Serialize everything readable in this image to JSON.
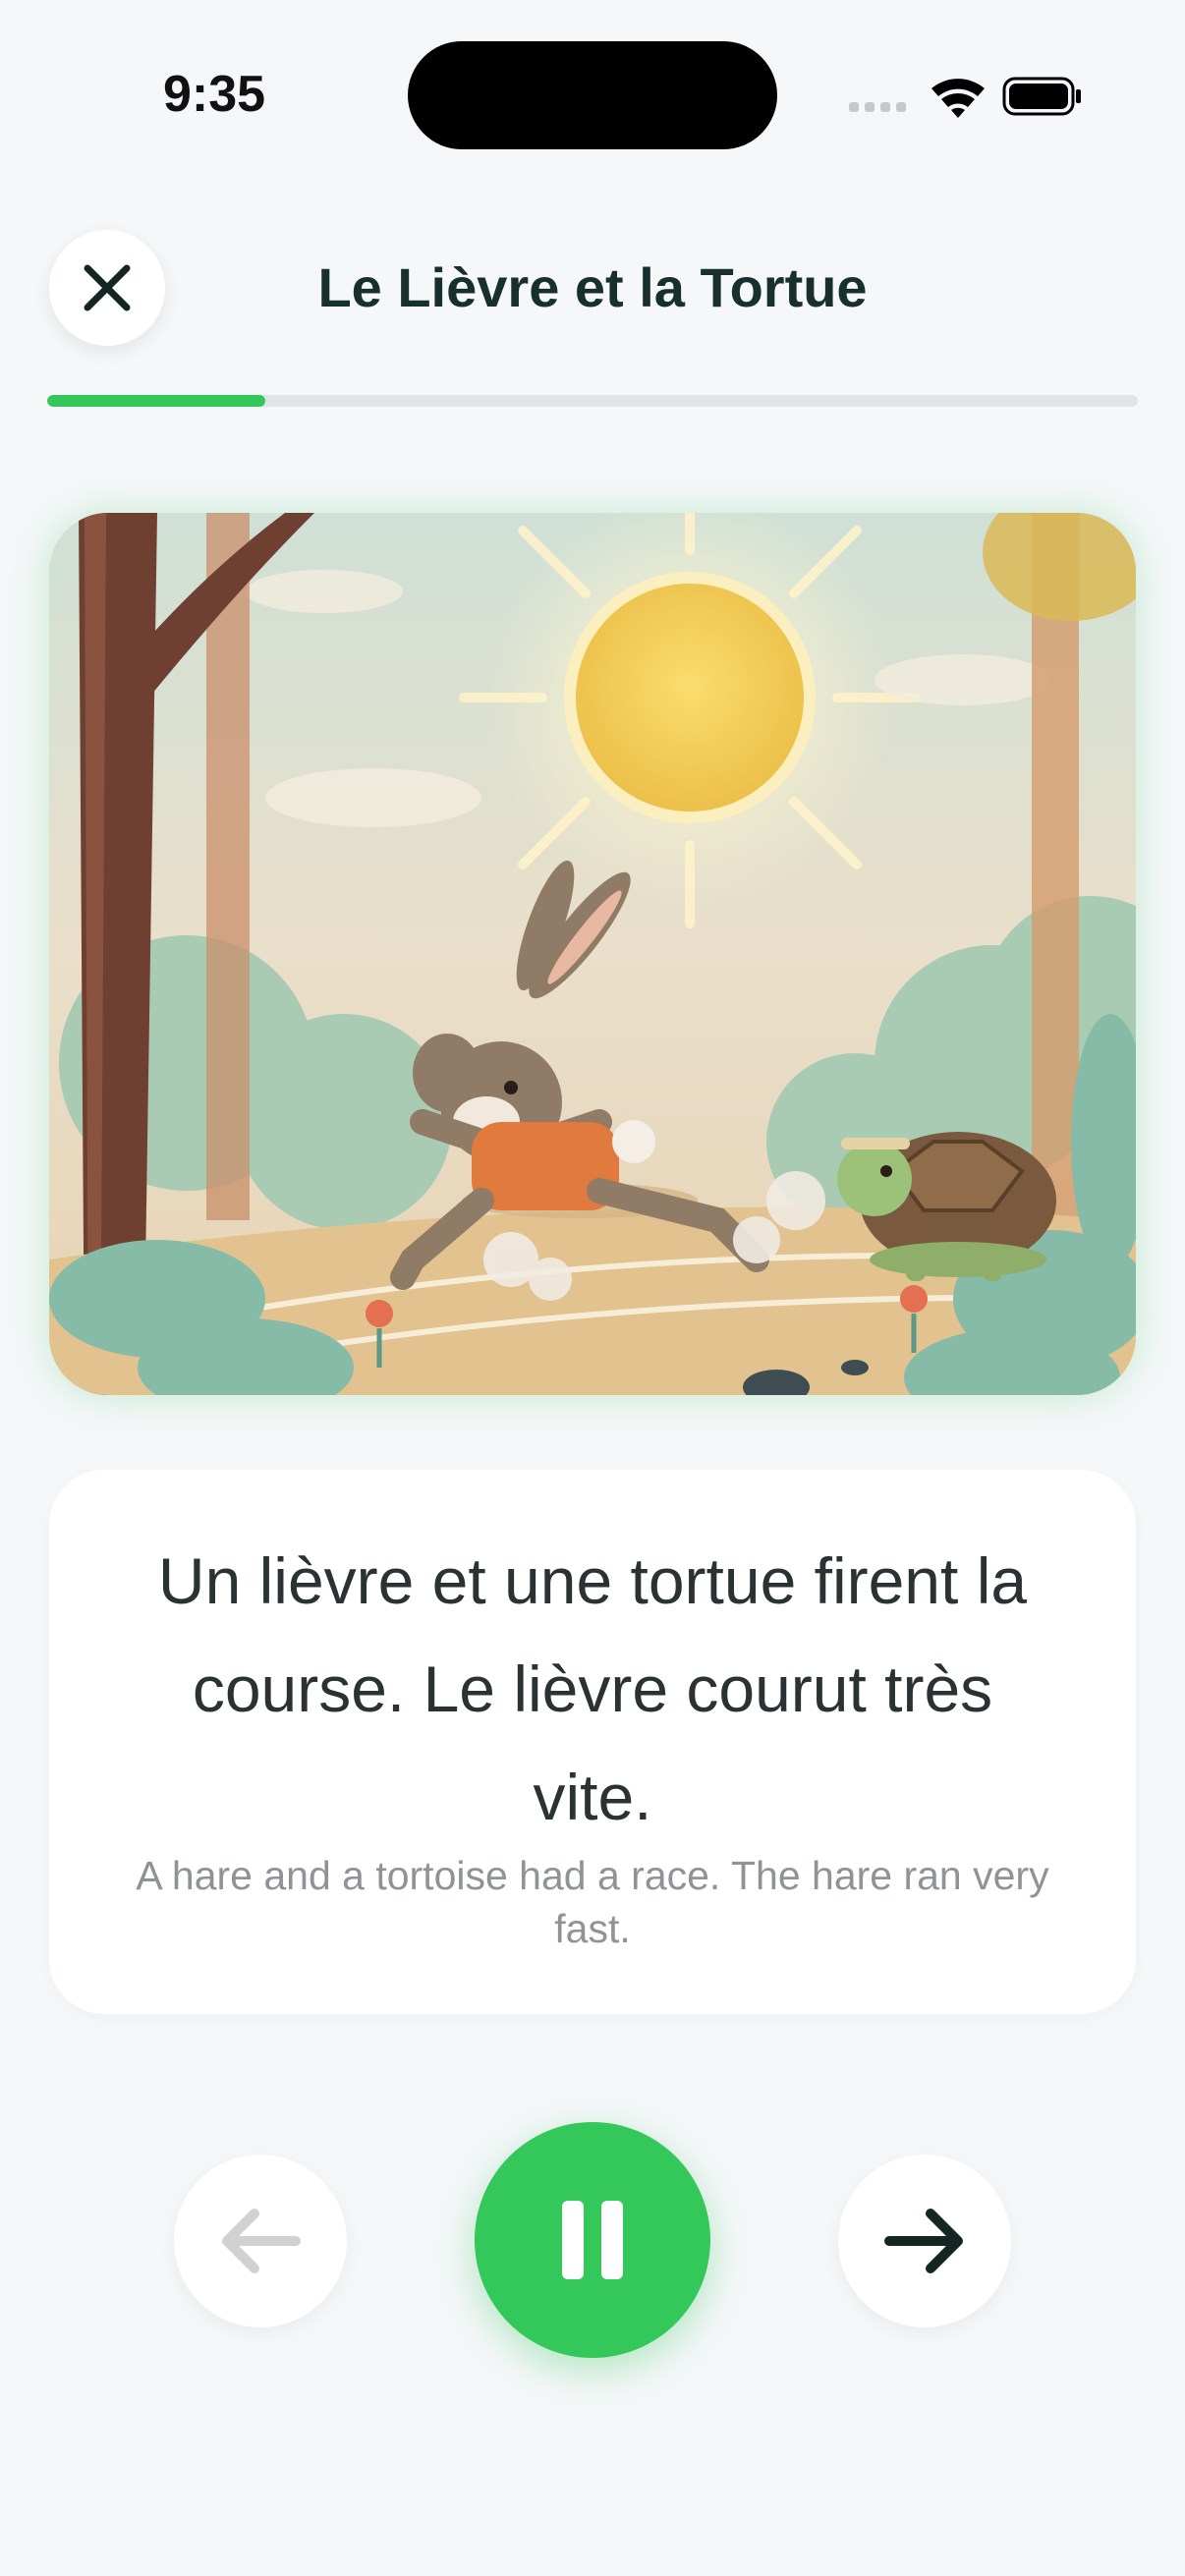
{
  "status_bar": {
    "time": "9:35"
  },
  "header": {
    "title": "Le Lièvre et la Tortue",
    "progress": 0.2
  },
  "story": {
    "french": "Un lièvre et une tortue firent la course. Le lièvre courut très vite.",
    "english": "A hare and a tortoise had a race. The hare ran very fast."
  },
  "icons": {
    "close": "close-icon",
    "previous": "arrow-left-icon",
    "pause": "pause-icon",
    "next": "arrow-right-icon"
  },
  "colors": {
    "accent": "#34c759",
    "background": "#f5f7f9",
    "title": "#17302d",
    "disabled": "#cfd1d3"
  },
  "controls": {
    "previous_enabled": false,
    "playing": true
  }
}
